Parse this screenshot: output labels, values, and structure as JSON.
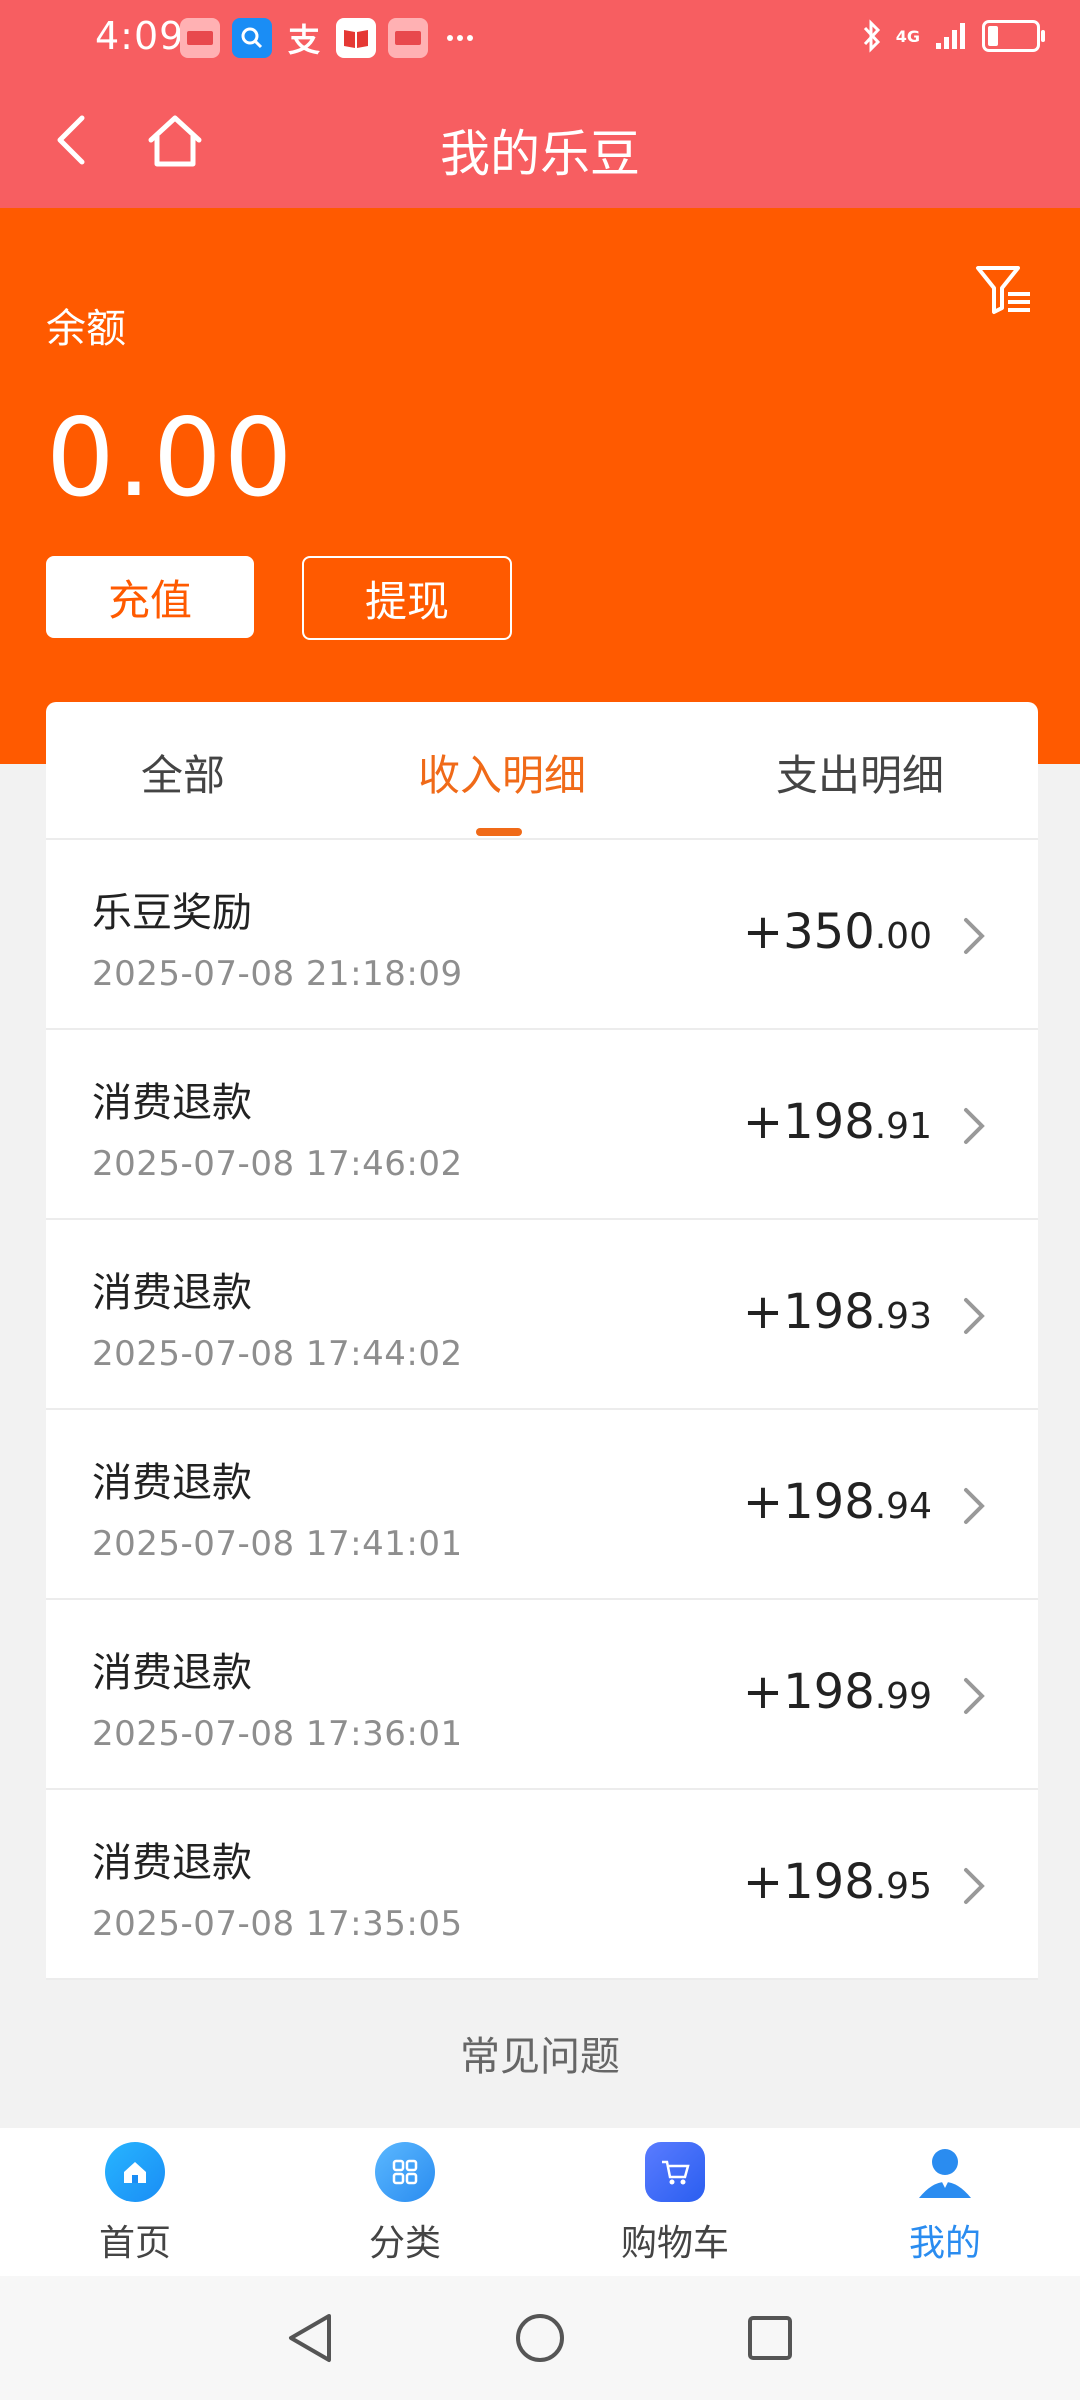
{
  "status_bar": {
    "time": "4:09",
    "icons": [
      "huawei-app-icon",
      "search-app-icon",
      "alipay-icon",
      "reader-app-icon",
      "huawei-app-icon",
      "more-icon"
    ],
    "network": "4G",
    "signal": "signal-icon",
    "bluetooth": "bluetooth-icon"
  },
  "header": {
    "title": "我的乐豆"
  },
  "balance": {
    "label": "余额",
    "amount": "0.00",
    "recharge_label": "充值",
    "withdraw_label": "提现"
  },
  "tabs": [
    {
      "label": "全部"
    },
    {
      "label": "收入明细"
    },
    {
      "label": "支出明细"
    }
  ],
  "active_tab": "收入明细",
  "records": [
    {
      "title": "乐豆奖励",
      "date": "2025-07-08 21:18:09",
      "amount_int": "+350",
      "amount_dec": ".00"
    },
    {
      "title": "消费退款",
      "date": "2025-07-08 17:46:02",
      "amount_int": "+198",
      "amount_dec": ".91"
    },
    {
      "title": "消费退款",
      "date": "2025-07-08 17:44:02",
      "amount_int": "+198",
      "amount_dec": ".93"
    },
    {
      "title": "消费退款",
      "date": "2025-07-08 17:41:01",
      "amount_int": "+198",
      "amount_dec": ".94"
    },
    {
      "title": "消费退款",
      "date": "2025-07-08 17:36:01",
      "amount_int": "+198",
      "amount_dec": ".99"
    },
    {
      "title": "消费退款",
      "date": "2025-07-08 17:35:05",
      "amount_int": "+198",
      "amount_dec": ".95"
    }
  ],
  "faq": {
    "label": "常见问题"
  },
  "bottom_nav": [
    {
      "label": "首页",
      "icon": "home-icon"
    },
    {
      "label": "分类",
      "icon": "category-icon"
    },
    {
      "label": "购物车",
      "icon": "cart-icon"
    },
    {
      "label": "我的",
      "icon": "user-icon"
    }
  ],
  "colors": {
    "header_bg": "#f75e61",
    "balance_bg": "#ff5a00",
    "accent": "#f06a18",
    "nav_active": "#2a8cf0"
  }
}
